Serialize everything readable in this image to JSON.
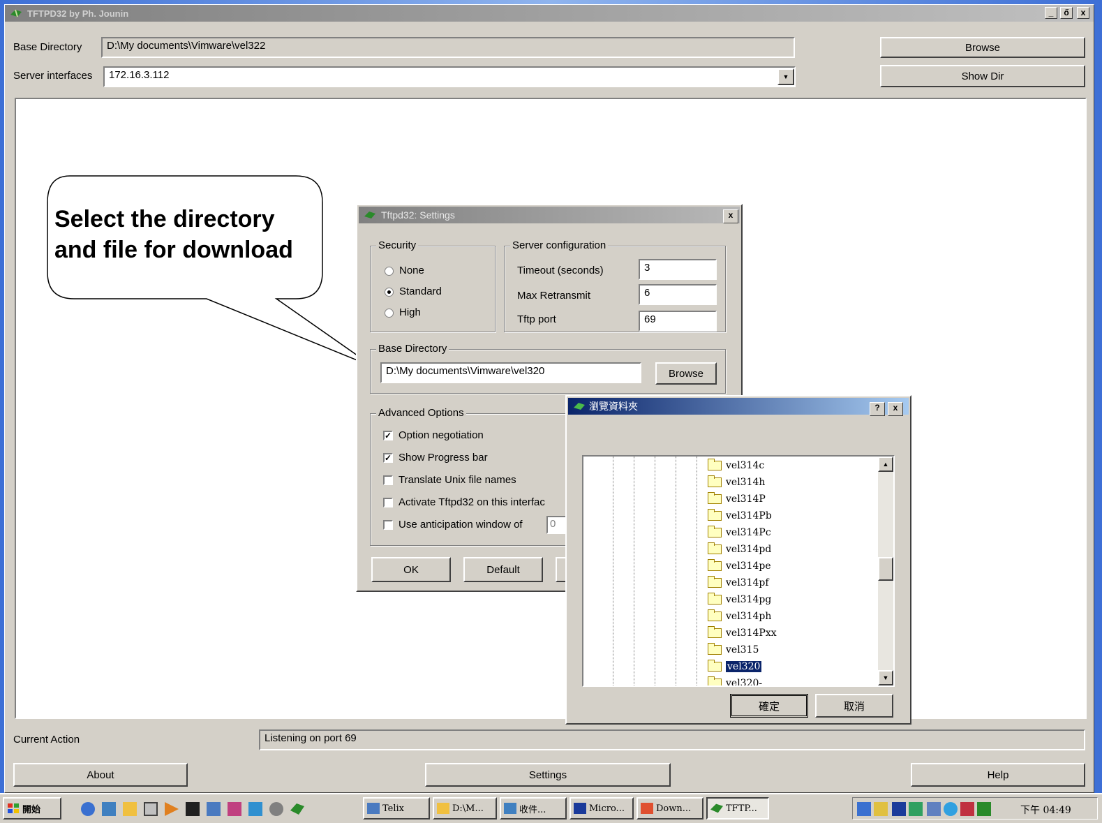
{
  "window": {
    "title": "TFTPD32 by Ph. Jounin",
    "minimize": "_",
    "restore": "ő",
    "close": "x"
  },
  "main": {
    "base_dir_label": "Base Directory",
    "base_dir_value": "D:\\My documents\\Vimware\\vel322",
    "server_if_label": "Server interfaces",
    "server_if_value": "172.16.3.112",
    "browse_label": "Browse",
    "show_dir_label": "Show Dir",
    "current_action_label": "Current Action",
    "current_action_value": "Listening on port 69",
    "about_label": "About",
    "settings_label": "Settings",
    "help_label": "Help"
  },
  "callout": {
    "line1": "Select the directory",
    "line2": "and file for download"
  },
  "settings_dialog": {
    "title": "Tftpd32: Settings",
    "close": "x",
    "security_title": "Security",
    "security_options": [
      "None",
      "Standard",
      "High"
    ],
    "security_selected": "Standard",
    "server_config_title": "Server configuration",
    "timeout_label": "Timeout (seconds)",
    "timeout_value": "3",
    "max_retransmit_label": "Max Retransmit",
    "max_retransmit_value": "6",
    "tftp_port_label": "Tftp port",
    "tftp_port_value": "69",
    "base_dir_title": "Base Directory",
    "base_dir_value": "D:\\My documents\\Vimware\\vel320",
    "browse_label": "Browse",
    "advanced_title": "Advanced Options",
    "options": [
      {
        "label": "Option negotiation",
        "checked": true
      },
      {
        "label": "Show Progress bar",
        "checked": true
      },
      {
        "label": "Translate Unix file names",
        "checked": false
      },
      {
        "label": "Activate Tftpd32 on this interfac",
        "checked": false
      },
      {
        "label": "Use anticipation window of",
        "checked": false
      }
    ],
    "anticipation_value": "0",
    "ok_label": "OK",
    "default_label": "Default"
  },
  "browse_dialog": {
    "title": "瀏覽資料夾",
    "help": "?",
    "close": "x",
    "folders": [
      "vel314c",
      "vel314h",
      "vel314P",
      "vel314Pb",
      "vel314Pc",
      "vel314pd",
      "vel314pe",
      "vel314pf",
      "vel314pg",
      "vel314ph",
      "vel314Pxx",
      "vel315",
      "vel320",
      "vel320-"
    ],
    "selected_folder": "vel320",
    "ok_label": "確定",
    "cancel_label": "取消"
  },
  "taskbar": {
    "start_label": "開始",
    "tasks": [
      "Telix",
      "D:\\M...",
      "收件...",
      "Micro...",
      "Down...",
      "TFTP..."
    ],
    "active_task": "TFTP...",
    "clock": "下午 04:49"
  },
  "colors": {
    "desktop": "#3d6fd6",
    "face": "#d4d0c8",
    "active_title": "#0a246a"
  }
}
